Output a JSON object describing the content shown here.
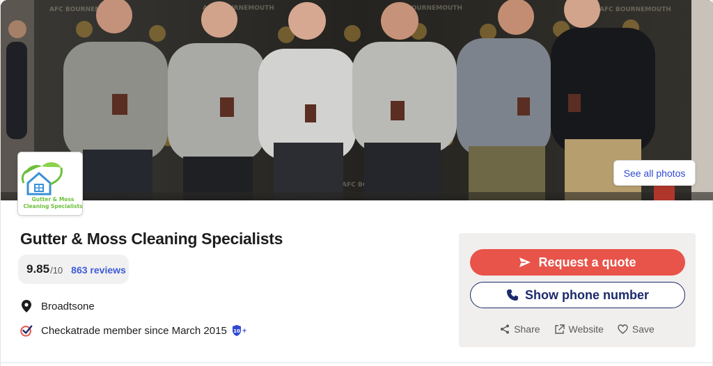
{
  "hero": {
    "see_all_label": "See all photos",
    "backdrop_text": "AFC BOURNEMOUTH"
  },
  "logo": {
    "line1": "Gutter & Moss",
    "line2": "Cleaning Specialists"
  },
  "business": {
    "name": "Gutter & Moss Cleaning Specialists",
    "score": "9.85",
    "score_out_of": "/10",
    "reviews_label": "863 reviews",
    "location": "Broadtsone",
    "membership": "Checkatrade member since March 2015",
    "badge_number": "10",
    "badge_suffix": "+"
  },
  "actions": {
    "quote_label": "Request a quote",
    "phone_label": "Show phone number",
    "share_label": "Share",
    "website_label": "Website",
    "save_label": "Save"
  },
  "icons": {
    "quote": "send-icon",
    "phone": "phone-icon",
    "share": "share-icon",
    "website": "external-link-icon",
    "save": "heart-icon",
    "location": "map-pin-icon",
    "member": "checkatrade-check-icon",
    "badge": "shield-badge-icon"
  },
  "colors": {
    "accent_red": "#e8534a",
    "navy": "#1c2a6b",
    "link_blue": "#3f5bd8",
    "panel_bg": "#f1efed"
  }
}
